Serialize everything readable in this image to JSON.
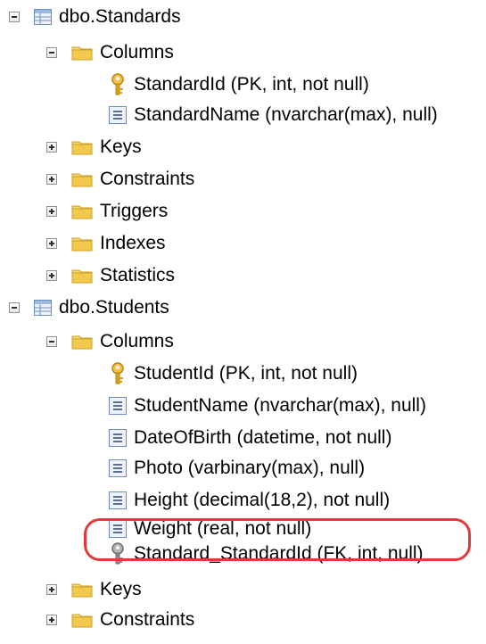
{
  "tree": {
    "standards": {
      "label": "dbo.Standards",
      "columns_label": "Columns",
      "columns": [
        "StandardId (PK, int, not null)",
        "StandardName (nvarchar(max), null)"
      ],
      "folders": [
        "Keys",
        "Constraints",
        "Triggers",
        "Indexes",
        "Statistics"
      ]
    },
    "students": {
      "label": "dbo.Students",
      "columns_label": "Columns",
      "columns": [
        "StudentId (PK, int, not null)",
        "StudentName (nvarchar(max), null)",
        "DateOfBirth (datetime, not null)",
        "Photo (varbinary(max), null)",
        "Height (decimal(18,2), not null)",
        "Weight (real, not null)",
        "Standard_StandardId (FK, int, null)"
      ],
      "folders": [
        "Keys",
        "Constraints"
      ]
    }
  },
  "colors": {
    "highlight": "#e23a3a",
    "folder": "#f2c94c",
    "table_icon": "#6c8ebf",
    "key_gold": "#d9a21b",
    "key_gray": "#8a8a8a"
  },
  "icons": {
    "table": "table-icon",
    "folder": "folder-icon",
    "column": "column-icon",
    "primary_key": "primary-key-icon",
    "foreign_key": "foreign-key-icon",
    "expand": "plus-expander-icon",
    "collapse": "minus-expander-icon"
  }
}
